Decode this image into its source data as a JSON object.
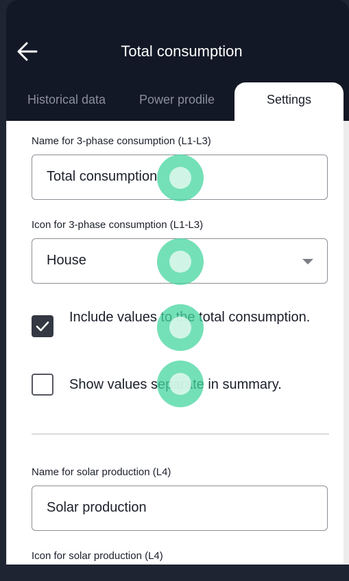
{
  "header": {
    "title": "Total consumption",
    "back_icon": "arrow-left-icon"
  },
  "tabs": [
    {
      "label": "Historical data",
      "active": false
    },
    {
      "label": "Power prodile",
      "active": false
    },
    {
      "label": "Settings",
      "active": true
    }
  ],
  "settings": {
    "phase_name_label": "Name for 3-phase consumption (L1-L3)",
    "phase_name_value": "Total consumption",
    "phase_icon_label": "Icon for 3-phase consumption (L1-L3)",
    "phase_icon_value": "House",
    "include_total_label": "Include values to the total consumption.",
    "include_total_checked": true,
    "show_separate_label": "Show values separate in summary.",
    "show_separate_checked": false,
    "solar_name_label": "Name for solar production (L4)",
    "solar_name_value": "Solar production",
    "solar_icon_label": "Icon for solar production (L4)"
  },
  "colors": {
    "header_bg": "#131826",
    "touch_indicator": "#46d6a0"
  }
}
